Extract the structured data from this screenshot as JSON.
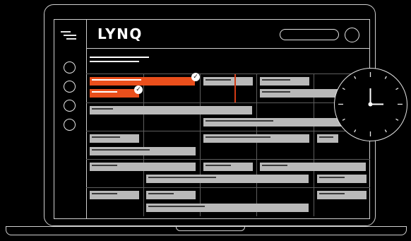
{
  "app": {
    "logo": "LYNQ"
  },
  "header": {
    "search_icon": "search-pill",
    "avatar_icon": "user-avatar-circle"
  },
  "sidebar": {
    "menu_icon": "hamburger-menu-icon",
    "items": [
      "nav-item-1",
      "nav-item-2",
      "nav-item-3",
      "nav-item-4",
      "nav-item-5"
    ]
  },
  "schedule": {
    "completed_tasks": 2
  },
  "colors": {
    "accent": "#ea4f1c",
    "bar": "#b9b9b9",
    "background": "#000000",
    "outline": "#cfcfcf"
  },
  "clock": {
    "icon": "clock-icon",
    "time": "3:00"
  }
}
